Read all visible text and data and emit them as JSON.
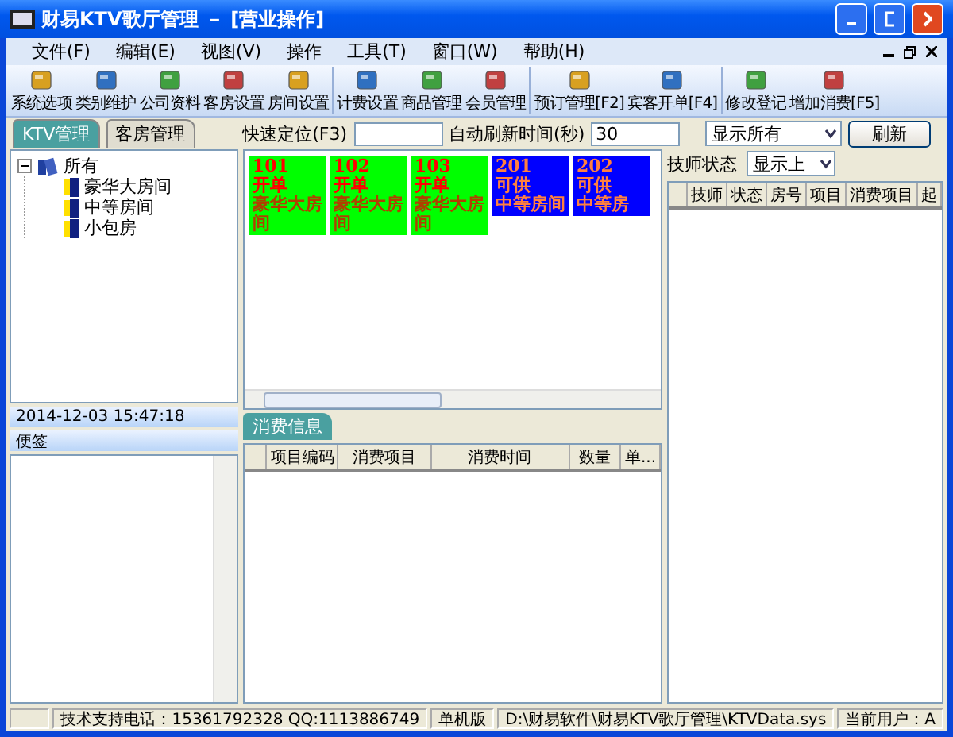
{
  "window": {
    "title": "财易KTV歌厅管理 － [营业操作]"
  },
  "menu": [
    "文件(F)",
    "编辑(E)",
    "视图(V)",
    "操作",
    "工具(T)",
    "窗口(W)",
    "帮助(H)"
  ],
  "toolbar_groups": [
    {
      "buttons": [
        "系统选项",
        "类别维护",
        "公司资料",
        "客房设置",
        "房间设置"
      ]
    },
    {
      "buttons": [
        "计费设置",
        "商品管理",
        "会员管理"
      ]
    },
    {
      "buttons": [
        "预订管理[F2]",
        "宾客开单[F4]"
      ]
    },
    {
      "buttons": [
        "修改登记",
        "增加消费[F5]"
      ]
    }
  ],
  "view_tabs": [
    {
      "label": "KTV管理",
      "selected": true
    },
    {
      "label": "客房管理",
      "selected": false
    }
  ],
  "quick_locate": {
    "label": "快速定位(F3)"
  },
  "refresh_interval": {
    "label": "自动刷新时间(秒)",
    "value": "30"
  },
  "room_filter": {
    "value": "显示所有"
  },
  "refresh_button": "刷新",
  "room_tree": {
    "label": "所有",
    "expanded": true,
    "children": [
      {
        "label": "豪华大房间"
      },
      {
        "label": "中等房间"
      },
      {
        "label": "小包房"
      }
    ]
  },
  "datetime": "2014-12-03 15:47:18",
  "notes": {
    "title": "便签"
  },
  "rooms": [
    {
      "number": "101",
      "status": "开单",
      "type": "豪华大房间",
      "kind": "occupied",
      "color": "#00ff00"
    },
    {
      "number": "102",
      "status": "开单",
      "type": "豪华大房间",
      "kind": "occupied",
      "color": "#00ff00"
    },
    {
      "number": "103",
      "status": "开单",
      "type": "豪华大房间",
      "kind": "occupied",
      "color": "#00ff00"
    },
    {
      "number": "201",
      "status": "可供",
      "type": "中等房间",
      "kind": "available",
      "color": "#0000ff"
    },
    {
      "number": "202",
      "status": "可供",
      "type": "中等房",
      "kind": "available",
      "color": "#0000ff"
    }
  ],
  "consumption": {
    "tab": "消费信息",
    "columns": [
      "项目编码",
      "消费项目",
      "消费时间",
      "数量",
      "单..."
    ]
  },
  "technicians": {
    "label": "技师状态",
    "filter": "显示上",
    "columns": [
      "技师",
      "状态",
      "房号",
      "项目",
      "消费项目",
      "起"
    ]
  },
  "status_bar": [
    "技术支持电话：15361792328 QQ:1113886749",
    "单机版",
    "D:\\财易软件\\财易KTV歌厅管理\\KTVData.sys",
    "当前用户：A"
  ]
}
